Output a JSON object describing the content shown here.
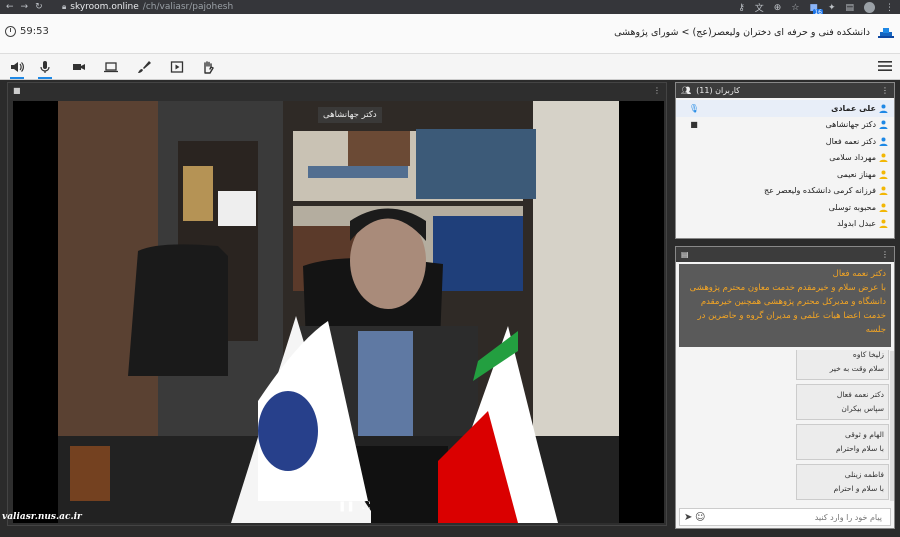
{
  "browser": {
    "url_host": "skyroom.online",
    "url_path": "/ch/valiasr/pajohesh",
    "ext_badge": "16"
  },
  "header": {
    "timer": "59:53",
    "title": "دانشکده فنی و حرفه ای دختران ولیعصر(عج) > شورای پژوهشی"
  },
  "video": {
    "speaker_tag": "دکتر جهانشاهی"
  },
  "users": {
    "title": "کاربران (11)",
    "items": [
      {
        "name": "علی عمادی"
      },
      {
        "name": "دکتر جهانشاهی"
      },
      {
        "name": "دکتر نعمه فعال"
      },
      {
        "name": "مهرداد سلامی"
      },
      {
        "name": "مهناز نعیمی"
      },
      {
        "name": "فرزانه کرمی دانشکده ولیعصر عج"
      },
      {
        "name": "محبوبه توسلی"
      },
      {
        "name": "عبدل ابدولد"
      }
    ]
  },
  "chat": {
    "pinned_sender": "دکتر نعمه فعال",
    "pinned_text": "با عرض سلام و خیرمقدم خدمت معاون محترم پژوهشی دانشگاه و مدیرکل محترم پژوهشی همچنین خیرمقدم خدمت اعضا هیات علمی و مدیران گروه و حاضرین  در جلسه",
    "messages": [
      {
        "sender": "زلیخا کاوه",
        "text": "سلام وقت به خیر"
      },
      {
        "sender": "دکتر نعمه فعال",
        "text": "سپاس بیکران"
      },
      {
        "sender": "الهام و ثوقی",
        "text": "با سلام واحترام"
      },
      {
        "sender": "فاطمه زینلی",
        "text": "با سلام و احترام"
      }
    ],
    "input_placeholder": "پیام خود را وارد کنید"
  },
  "watermark": "valiasr.nus.ac.ir",
  "colors": {
    "accent": "#1e88e5",
    "pinned_text": "#f5a623",
    "user_icon": "#f2b705"
  }
}
